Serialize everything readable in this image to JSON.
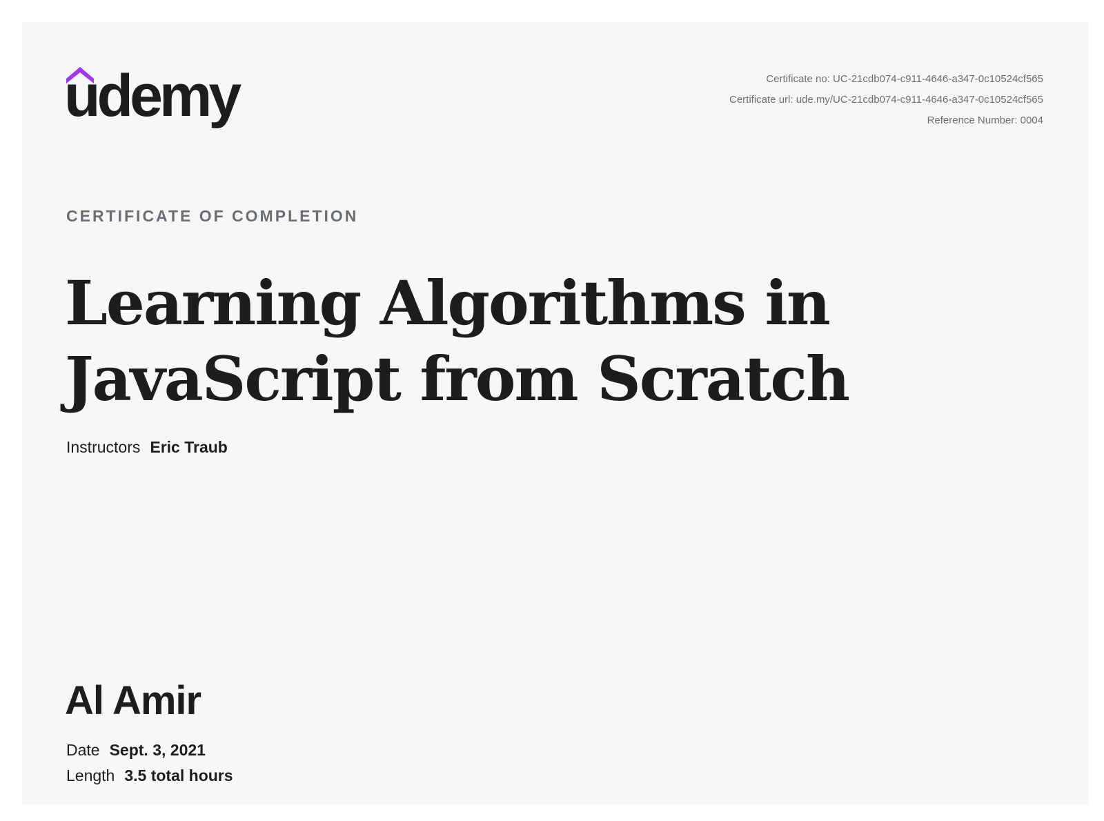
{
  "brand": {
    "name": "udemy",
    "colors": {
      "accent": "#a435f0",
      "text": "#1c1d1f",
      "muted": "#6a6f73",
      "background": "#f7f7f8"
    }
  },
  "meta": {
    "certificate_no": "Certificate no: UC-21cdb074-c911-4646-a347-0c10524cf565",
    "certificate_url": "Certificate url: ude.my/UC-21cdb074-c911-4646-a347-0c10524cf565",
    "reference_number": "Reference Number: 0004"
  },
  "certificate": {
    "heading": "CERTIFICATE OF COMPLETION",
    "course_title": "Learning Algorithms in JavaScript from Scratch",
    "instructors_label": "Instructors",
    "instructors_value": "Eric Traub",
    "student_name": "Al Amir",
    "date_label": "Date",
    "date_value": "Sept. 3, 2021",
    "length_label": "Length",
    "length_value": "3.5 total hours"
  }
}
